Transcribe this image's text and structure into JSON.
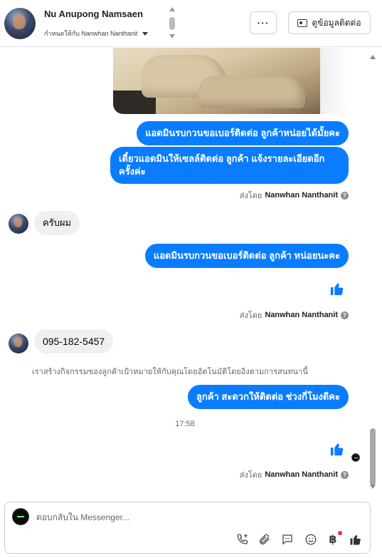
{
  "header": {
    "name": "Nu Anupong Namsaen",
    "assigned_text": "กำหนดให้กับ Nanwhan Nanthanit",
    "more_label": "···",
    "contact_label": "ดูข้อมูลติดต่อ"
  },
  "messages": {
    "out1": "แอดมินรบกวนขอเบอร์ติดต่อ ลูกค้าหน่อยได้มั้ยคะ",
    "out2": "เดี๋ยวแอดมินให้เซลล์ติดต่อ ลูกค้า แจ้งรายละเอียดอีกครั้งค่ะ",
    "sent_by_1_prefix": "ส่งโดย",
    "sent_by_1_name": "Nanwhan Nanthanit",
    "in1": "ครับผม",
    "out3": "แอดมินรบกวนขอเบอร์ติดต่อ ลูกค้า หน่อยนะคะ",
    "sent_by_2_prefix": "ส่งโดย",
    "sent_by_2_name": "Nanwhan Nanthanit",
    "in2": "095-182-5457",
    "system_note": "เราสร้างกิจกรรมของลูกค้าเป้าหมายให้กับคุณโดยอัตโนมัติโดยอิงตามการสนทนานี้",
    "out4": "ลูกค้า สะดวกให้ติดต่อ ช่วงกี่โมงดีคะ",
    "time": "17:58",
    "sent_by_3_prefix": "ส่งโดย",
    "sent_by_3_name": "Nanwhan Nanthanit",
    "help_glyph": "?"
  },
  "composer": {
    "placeholder": "ตอบกลับใน Messenger...",
    "baht_symbol": "฿"
  },
  "colors": {
    "outgoing_bubble": "#0a7cff",
    "incoming_bubble": "#f0f0f0",
    "like_icon": "#0a7cff",
    "notification_dot": "#f02849"
  },
  "icons": [
    "thumbs-up-icon",
    "phone-add-icon",
    "paperclip-icon",
    "chat-bubble-icon",
    "smiley-icon",
    "baht-icon",
    "id-card-icon"
  ]
}
